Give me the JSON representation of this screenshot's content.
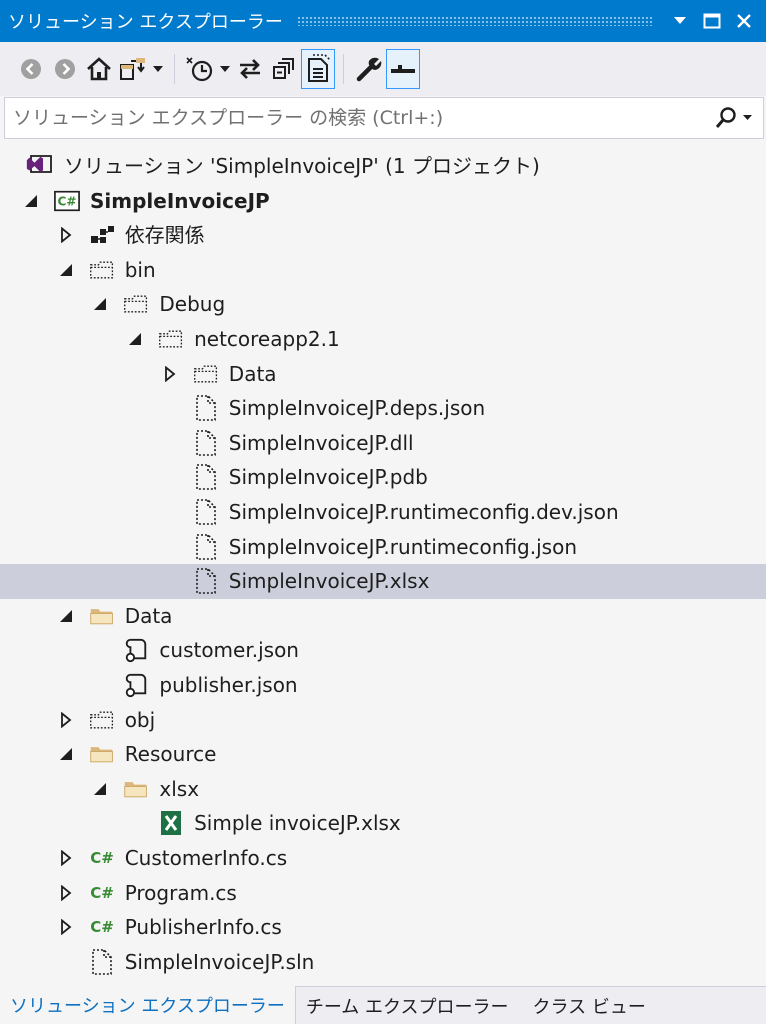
{
  "window": {
    "title": "ソリューション エクスプローラー"
  },
  "toolbar": {
    "buttons": [
      "back-icon",
      "forward-icon",
      "home-icon",
      "switch-views-icon",
      "pending-changes-filter-icon",
      "sync-icon",
      "collapse-all-icon",
      "show-all-files-icon",
      "properties-icon",
      "preview-icon"
    ]
  },
  "search": {
    "placeholder": "ソリューション エクスプローラー の検索 (Ctrl+:)"
  },
  "tree": [
    {
      "label": "ソリューション 'SimpleInvoiceJP' (1 プロジェクト)",
      "icon": "solution-icon",
      "expander": "none",
      "bold": false
    },
    {
      "label": "SimpleInvoiceJP",
      "icon": "csharp-project-icon",
      "expander": "expanded",
      "bold": true
    },
    {
      "label": "依存関係",
      "icon": "dependencies-icon",
      "expander": "collapsed",
      "bold": false
    },
    {
      "label": "bin",
      "icon": "hidden-folder-icon",
      "expander": "expanded",
      "bold": false
    },
    {
      "label": "Debug",
      "icon": "hidden-folder-icon",
      "expander": "expanded",
      "bold": false
    },
    {
      "label": "netcoreapp2.1",
      "icon": "hidden-folder-icon",
      "expander": "expanded",
      "bold": false
    },
    {
      "label": "Data",
      "icon": "hidden-folder-icon",
      "expander": "collapsed",
      "bold": false
    },
    {
      "label": "SimpleInvoiceJP.deps.json",
      "icon": "hidden-file-icon",
      "expander": "none",
      "bold": false
    },
    {
      "label": "SimpleInvoiceJP.dll",
      "icon": "hidden-file-icon",
      "expander": "none",
      "bold": false
    },
    {
      "label": "SimpleInvoiceJP.pdb",
      "icon": "hidden-file-icon",
      "expander": "none",
      "bold": false
    },
    {
      "label": "SimpleInvoiceJP.runtimeconfig.dev.json",
      "icon": "hidden-file-icon",
      "expander": "none",
      "bold": false
    },
    {
      "label": "SimpleInvoiceJP.runtimeconfig.json",
      "icon": "hidden-file-icon",
      "expander": "none",
      "bold": false
    },
    {
      "label": "SimpleInvoiceJP.xlsx",
      "icon": "hidden-file-icon",
      "expander": "none",
      "bold": false,
      "selected": true
    },
    {
      "label": "Data",
      "icon": "folder-icon",
      "expander": "expanded",
      "bold": false
    },
    {
      "label": "customer.json",
      "icon": "json-file-icon",
      "expander": "none",
      "bold": false
    },
    {
      "label": "publisher.json",
      "icon": "json-file-icon",
      "expander": "none",
      "bold": false
    },
    {
      "label": "obj",
      "icon": "hidden-folder-icon",
      "expander": "collapsed",
      "bold": false
    },
    {
      "label": "Resource",
      "icon": "folder-icon",
      "expander": "expanded",
      "bold": false
    },
    {
      "label": "xlsx",
      "icon": "folder-icon",
      "expander": "expanded",
      "bold": false
    },
    {
      "label": "Simple invoiceJP.xlsx",
      "icon": "excel-file-icon",
      "expander": "none",
      "bold": false
    },
    {
      "label": "CustomerInfo.cs",
      "icon": "csharp-file-icon",
      "expander": "collapsed",
      "bold": false
    },
    {
      "label": "Program.cs",
      "icon": "csharp-file-icon",
      "expander": "collapsed",
      "bold": false
    },
    {
      "label": "PublisherInfo.cs",
      "icon": "csharp-file-icon",
      "expander": "collapsed",
      "bold": false
    },
    {
      "label": "SimpleInvoiceJP.sln",
      "icon": "hidden-file-icon",
      "expander": "none",
      "bold": false
    }
  ],
  "tabs": [
    {
      "label": "ソリューション エクスプローラー",
      "active": true
    },
    {
      "label": "チーム エクスプローラー",
      "active": false
    },
    {
      "label": "クラス ビュー",
      "active": false
    }
  ],
  "colors": {
    "accent": "#007ACC",
    "selection": "#CCCEDB",
    "folder": "#DCB67A",
    "csharp": "#388A34",
    "excel": "#1E7145",
    "solution": "#68217A"
  }
}
